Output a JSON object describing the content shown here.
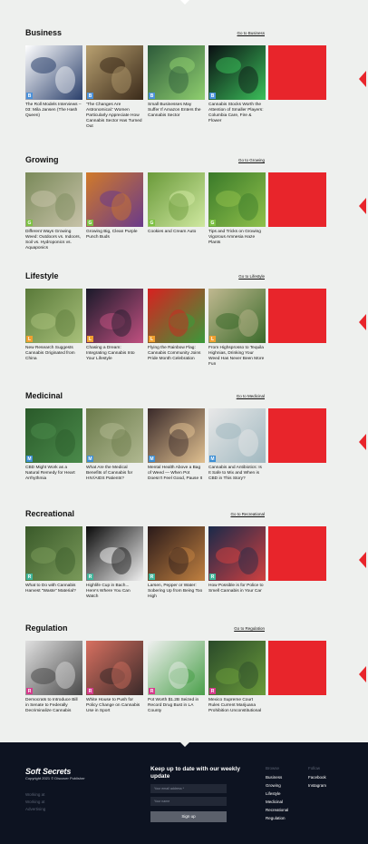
{
  "sections": [
    {
      "title": "Business",
      "link": "Go to Business",
      "letter": "B",
      "color": "#4a90d9",
      "cards": [
        "The Roll Models Interviews – 03: Mila Jansen (The Hash Queen)",
        "'The Changes Are Astronomical:' Women Particularly Appreciate How Cannabis Sector Has Turned Out",
        "Small Businesses May Suffer If Amazon Enters the Cannabis Sector",
        "Cannabis Stocks Worth the Attention of Smaller Players: Columbia Care, Fire & Flower"
      ]
    },
    {
      "title": "Growing",
      "link": "Go to Growing",
      "letter": "G",
      "color": "#7cc242",
      "cards": [
        "Different Ways Growing Weed: Outdoors vs. Indoors, Soil vs. Hydroponics vs. Aquaponics",
        "Growing Big, Clean Purple Punch Buds",
        "Cookies and Cream Auto",
        "Tips and Tricks on Growing Vigorous Amnesia Haze Plants"
      ]
    },
    {
      "title": "Lifestyle",
      "link": "Go to Lifestyle",
      "letter": "L",
      "color": "#f0a030",
      "cards": [
        "New Research Suggests Cannabis Originated from China",
        "Chasing a Dream: Integrating Cannabis Into Your Lifestyle",
        "Flying the Rainbow Flag: Cannabis Community Joins Pride Month Celebration",
        "From Highsprosso to Tequila Highnias, Drinking Your Weed Has Never Been More Fun"
      ]
    },
    {
      "title": "Medicinal",
      "link": "Go to Medicinal",
      "letter": "M",
      "color": "#3d8fd4",
      "cards": [
        "CBD Might Work as a Natural Remedy for Heart Arrhythmia",
        "What Are the Medical Benefits of Cannabis for HIV/AIDS Patients?",
        "Mental Health Above a Bag of Weed — When Pot Doesn't Feel Good, Pause It",
        "Cannabis and Antibiotics: Is It Safe to Mix and When is CBD in This Story?"
      ]
    },
    {
      "title": "Recreational",
      "link": "Go to Recreational",
      "letter": "R",
      "color": "#3fb59a",
      "cards": [
        "What to Do with Cannabis Harvest \"Waste\" Material?",
        "Highlife Cup in Bach... Here's Where You Can Watch",
        "Larsen, Pepper or Water: Sobering Up from Being Too High",
        "How Possible is for Police to Smell Cannabis in Your Car"
      ]
    },
    {
      "title": "Regulation",
      "link": "Go to Regulation",
      "letter": "R",
      "color": "#d63a8c",
      "cards": [
        "Democrats to Introduce Bill in Senate to Federally Decriminalize Cannabis",
        "White House to Push for Policy Change on Cannabis Use in Sport",
        "Pot Worth $1.2B Seized in Record Drug Bust in LA County",
        "Mexico Supreme Court Rules Current Marijuana Prohibition Unconstitutional"
      ]
    }
  ],
  "footer": {
    "logo": "Soft Secrets",
    "copyright": "Copyright 2021 © Discover Publisher",
    "links": [
      "Working at",
      "Working at",
      "Advertising"
    ],
    "newsletter_title": "Keep up to date with our weekly update",
    "email_placeholder": "Your email address *",
    "name_placeholder": "Your name",
    "signup": "Sign up",
    "browse_head": "Browse",
    "browse": [
      "Business",
      "Growing",
      "Lifestyle",
      "Medicinal",
      "Recreational",
      "Regulation"
    ],
    "follow_head": "Follow",
    "follow": [
      "Facebook",
      "Instagram"
    ]
  }
}
